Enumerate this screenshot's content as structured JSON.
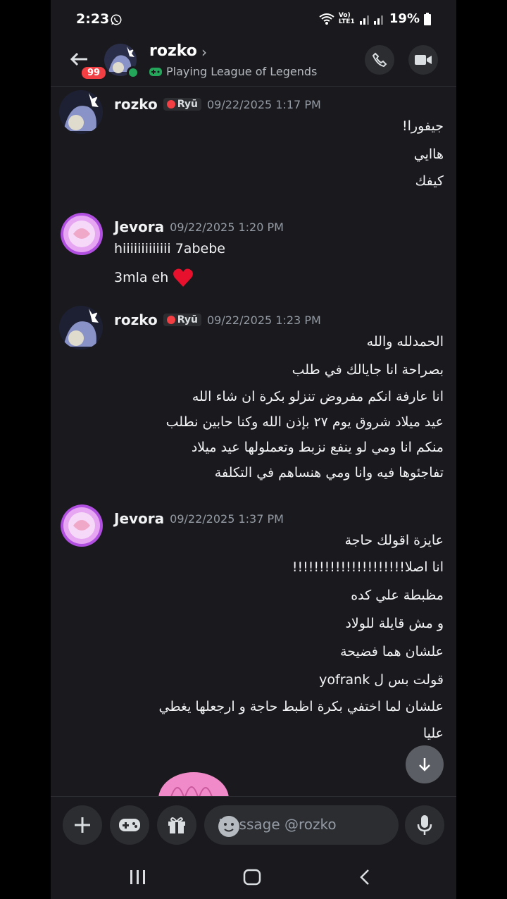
{
  "status": {
    "time": "2:23",
    "battery": "19%",
    "network": "Vo) LTE1"
  },
  "header": {
    "name": "rozko",
    "activity": "Playing League of Legends",
    "unread_badge": "99"
  },
  "messages": [
    {
      "author": "rozko",
      "tag": "Ryū",
      "timestamp": "09/22/2025 1:17 PM",
      "lines": [
        "جيفورا!",
        "هاايي",
        "كيفك"
      ]
    },
    {
      "author": "Jevora",
      "timestamp": "09/22/2025 1:20 PM",
      "lines": [
        "hiiiiiiiiiiiii 7abebe",
        "3mla eh"
      ]
    },
    {
      "author": "rozko",
      "tag": "Ryū",
      "timestamp": "09/22/2025 1:23 PM",
      "lines": [
        "الحمدلله والله",
        "بصراحة انا جايالك في طلب",
        "انا عارفة انكم مفروض تنزلو بكرة ان شاء الله",
        "عيد ميلاد شروق يوم ٢٧ بإذن الله وكنا حابين نطلب",
        "منكم انا ومي لو ينفع نزبط وتعملولها عيد ميلاد",
        "تفاجئوها فيه وانا ومي هنساهم في التكلفة"
      ]
    },
    {
      "author": "Jevora",
      "timestamp": "09/22/2025 1:37 PM",
      "lines": [
        "عايزة اقولك حاجة",
        "انا اصلا!!!!!!!!!!!!!!!!!!!!!",
        "مظبطة علي كده",
        "و مش قايلة للولاد",
        "علشان هما فضيحة",
        "قولت بس ل yofrank",
        "علشان لما اختفي بكرة اظبط حاجة و ارجعلها يغطي",
        "عليا"
      ]
    }
  ],
  "composer": {
    "placeholder": "Message @rozko"
  },
  "colors": {
    "background": "#1a1a1e",
    "online": "#23a55a",
    "badge": "#f23f43",
    "heart": "#e8112d"
  }
}
